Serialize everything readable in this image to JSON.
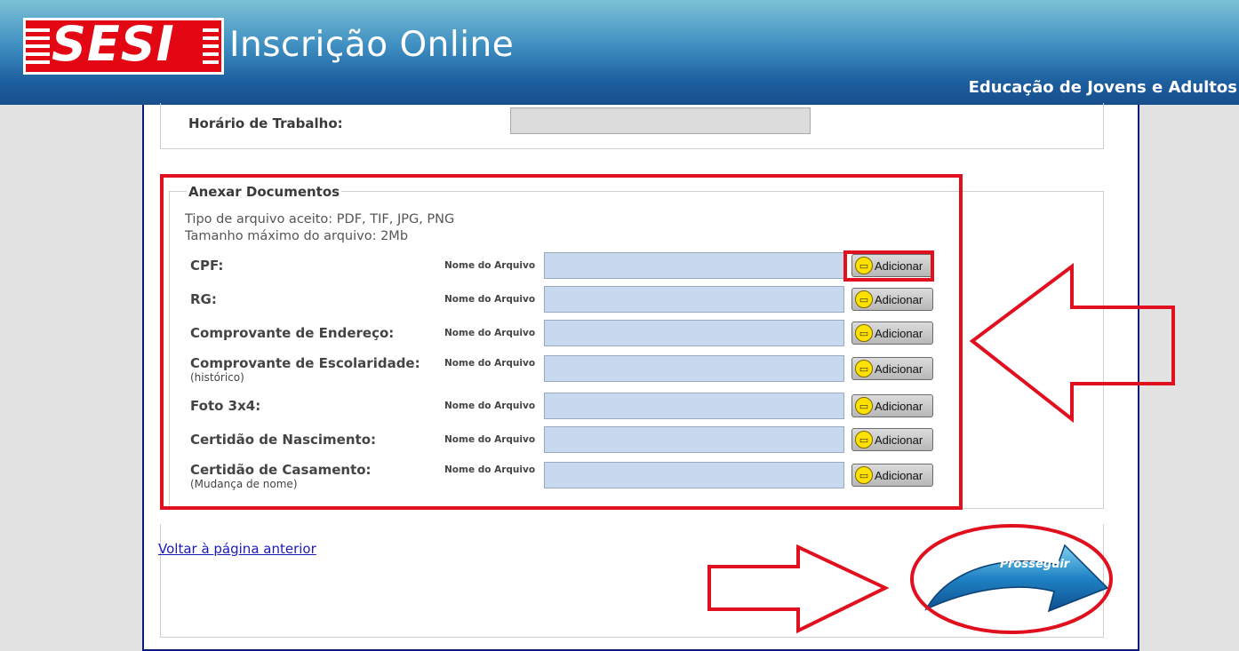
{
  "header": {
    "logo_text": "SESI",
    "title": "Inscrição Online",
    "subtitle": "Educação de Jovens e Adultos"
  },
  "work": {
    "label": "Horário de Trabalho:",
    "value": ""
  },
  "documents": {
    "legend": "Anexar Documentos",
    "accepted_types": "Tipo de arquivo aceito: PDF, TIF, JPG, PNG",
    "max_size": "Tamanho máximo do arquivo: 2Mb",
    "file_caption": "Nome do Arquivo",
    "add_label": "Adicionar",
    "rows": [
      {
        "label": "CPF:",
        "sub": "",
        "value": ""
      },
      {
        "label": "RG:",
        "sub": "",
        "value": ""
      },
      {
        "label": "Comprovante de Endereço:",
        "sub": "",
        "value": ""
      },
      {
        "label": "Comprovante de Escolaridade:",
        "sub": "(histórico)",
        "value": ""
      },
      {
        "label": "Foto 3x4:",
        "sub": "",
        "value": ""
      },
      {
        "label": "Certidão de Nascimento:",
        "sub": "",
        "value": ""
      },
      {
        "label": "Certidão de Casamento:",
        "sub": "(Mudança de nome)",
        "value": ""
      }
    ]
  },
  "nav": {
    "back_link": "Voltar à página anterior",
    "next_button": "Prosseguir"
  },
  "colors": {
    "highlight": "#e0101e",
    "header_top": "#7cc2d6",
    "header_bottom": "#174f8c",
    "input_fill": "#c6d9ee",
    "logo_red": "#e30613"
  },
  "icons": {
    "add": "document-add-icon",
    "next": "curved-arrow-icon"
  }
}
